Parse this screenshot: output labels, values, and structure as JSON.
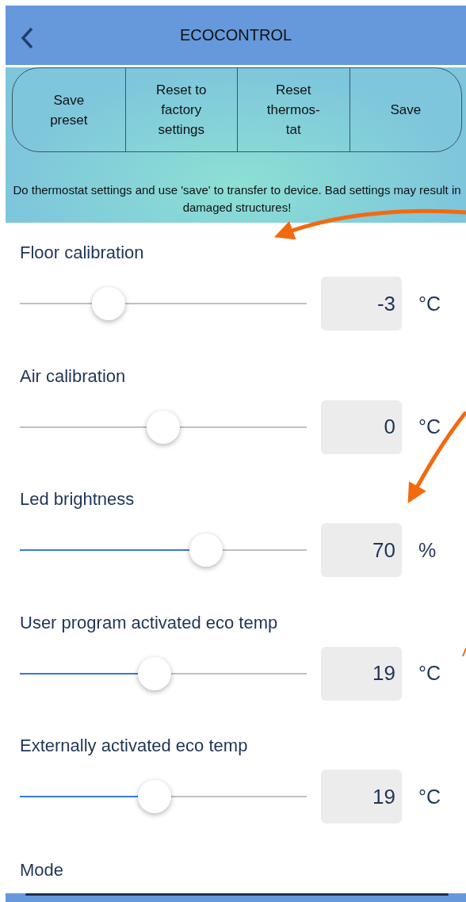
{
  "header": {
    "title": "ECOCONTROL"
  },
  "actions": [
    "Save preset",
    "Reset to factory settings",
    "Reset thermos-tat",
    "Save"
  ],
  "notice": "Do thermostat settings and use 'save' to transfer to device. Bad settings may result in damaged structures!",
  "settings": [
    {
      "label": "Floor calibration",
      "kind": "plain",
      "level": 0.31,
      "value": "-3",
      "unit": "°C"
    },
    {
      "label": "Air calibration",
      "kind": "plain",
      "level": 0.5,
      "value": "0",
      "unit": "°C"
    },
    {
      "label": "Led brightness",
      "kind": "filled",
      "level": 0.65,
      "value": "70",
      "unit": "%"
    },
    {
      "label": "User program activated eco temp",
      "kind": "filled",
      "level": 0.47,
      "value": "19",
      "unit": "°C"
    },
    {
      "label": "Externally activated eco temp",
      "kind": "filled",
      "level": 0.47,
      "value": "19",
      "unit": "°C"
    }
  ],
  "mode": {
    "label": "Mode"
  }
}
